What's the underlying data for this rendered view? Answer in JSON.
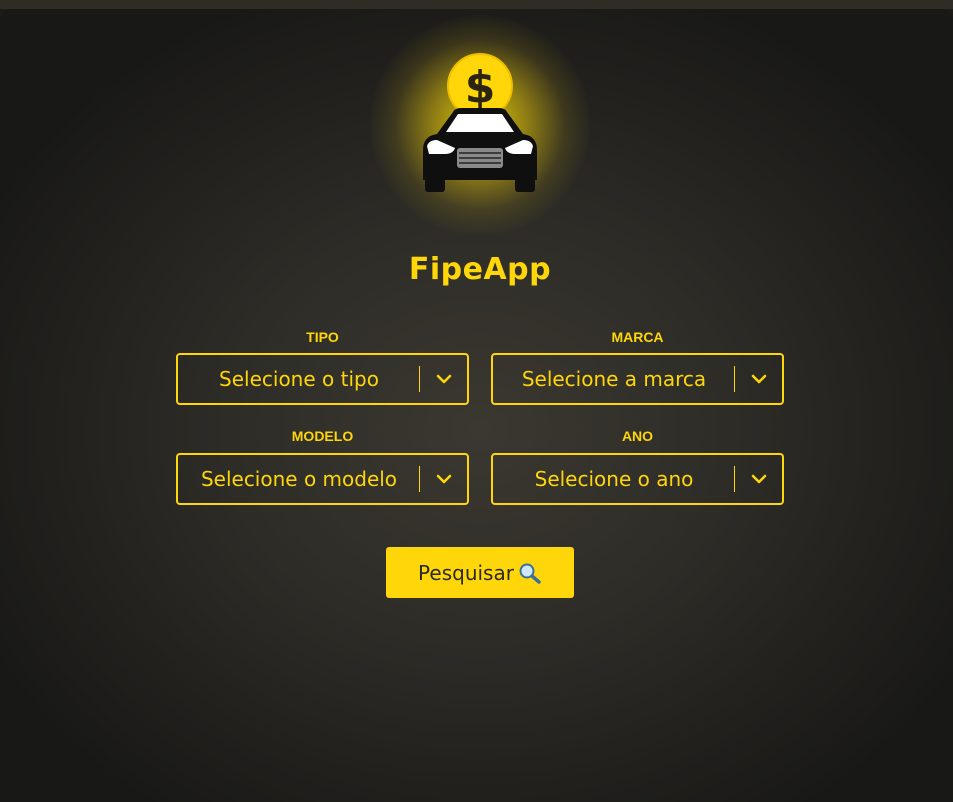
{
  "app": {
    "title": "FipeApp"
  },
  "logo": {
    "icon": "car-with-dollar-coin-icon",
    "coin_symbol": "$"
  },
  "form": {
    "tipo": {
      "label": "TIPO",
      "value": "Selecione o tipo"
    },
    "marca": {
      "label": "MARCA",
      "value": "Selecione a marca"
    },
    "modelo": {
      "label": "MODELO",
      "value": "Selecione o modelo"
    },
    "ano": {
      "label": "ANO",
      "value": "Selecione o ano"
    }
  },
  "search_button": {
    "label": "Pesquisar",
    "icon": "magnifier-icon"
  },
  "colors": {
    "accent": "#ffd60a",
    "background": "#2e2c27",
    "car": "#0f0f0f"
  }
}
